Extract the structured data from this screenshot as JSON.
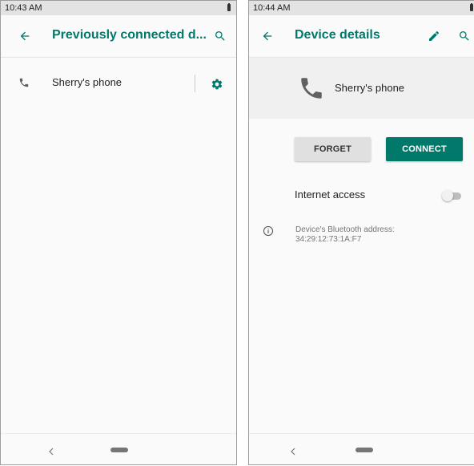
{
  "colors": {
    "accent": "#00796b",
    "status_bar": "#e3e3e3",
    "background": "#fafafa"
  },
  "left_screen": {
    "status_time": "10:43 AM",
    "title": "Previously connected d...",
    "icons": {
      "back": "arrow-back-icon",
      "search": "search-icon",
      "device": "phone-icon",
      "settings": "gear-icon"
    },
    "device": {
      "name": "Sherry's phone"
    },
    "nav": {
      "back": "nav-back-icon",
      "home": "nav-home-pill"
    }
  },
  "right_screen": {
    "status_time": "10:44 AM",
    "title": "Device details",
    "icons": {
      "back": "arrow-back-icon",
      "edit": "pencil-icon",
      "search": "search-icon",
      "device": "phone-icon",
      "info": "info-icon"
    },
    "device": {
      "name": "Sherry's phone"
    },
    "buttons": {
      "forget": "FORGET",
      "connect": "CONNECT"
    },
    "internet_access": {
      "label": "Internet access",
      "enabled": false
    },
    "bluetooth": {
      "label": "Device's Bluetooth address:",
      "address": "34:29:12:73:1A:F7"
    },
    "nav": {
      "back": "nav-back-icon",
      "home": "nav-home-pill"
    }
  }
}
